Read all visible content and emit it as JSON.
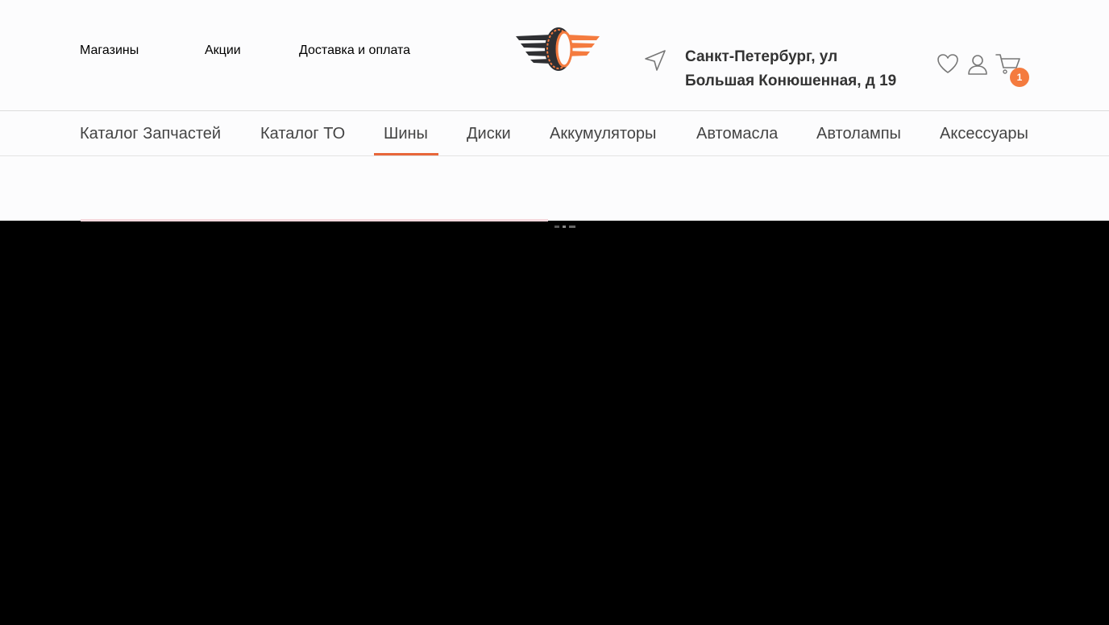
{
  "header": {
    "nav": [
      "Магазины",
      "Акции",
      "Доставка и оплата"
    ],
    "address_line1": "Санкт-Петербург, ул",
    "address_line2": "Большая Конюшенная, д 19",
    "cart_count": "1"
  },
  "catalog": {
    "items": [
      "Каталог Запчастей",
      "Каталог ТО",
      "Шины",
      "Диски",
      "Аккумуляторы",
      "Автомасла",
      "Автолампы",
      "Аксессуары"
    ],
    "active": "Шины"
  },
  "icons": {
    "logo": "tire-wings-logo",
    "location": "navigation-arrow-icon",
    "favorites": "heart-icon",
    "account": "user-icon",
    "cart": "cart-icon"
  },
  "colors": {
    "accent": "#f47b3f",
    "underline": "#e8663a",
    "text": "#333333",
    "logo_dark": "#2f3033"
  }
}
